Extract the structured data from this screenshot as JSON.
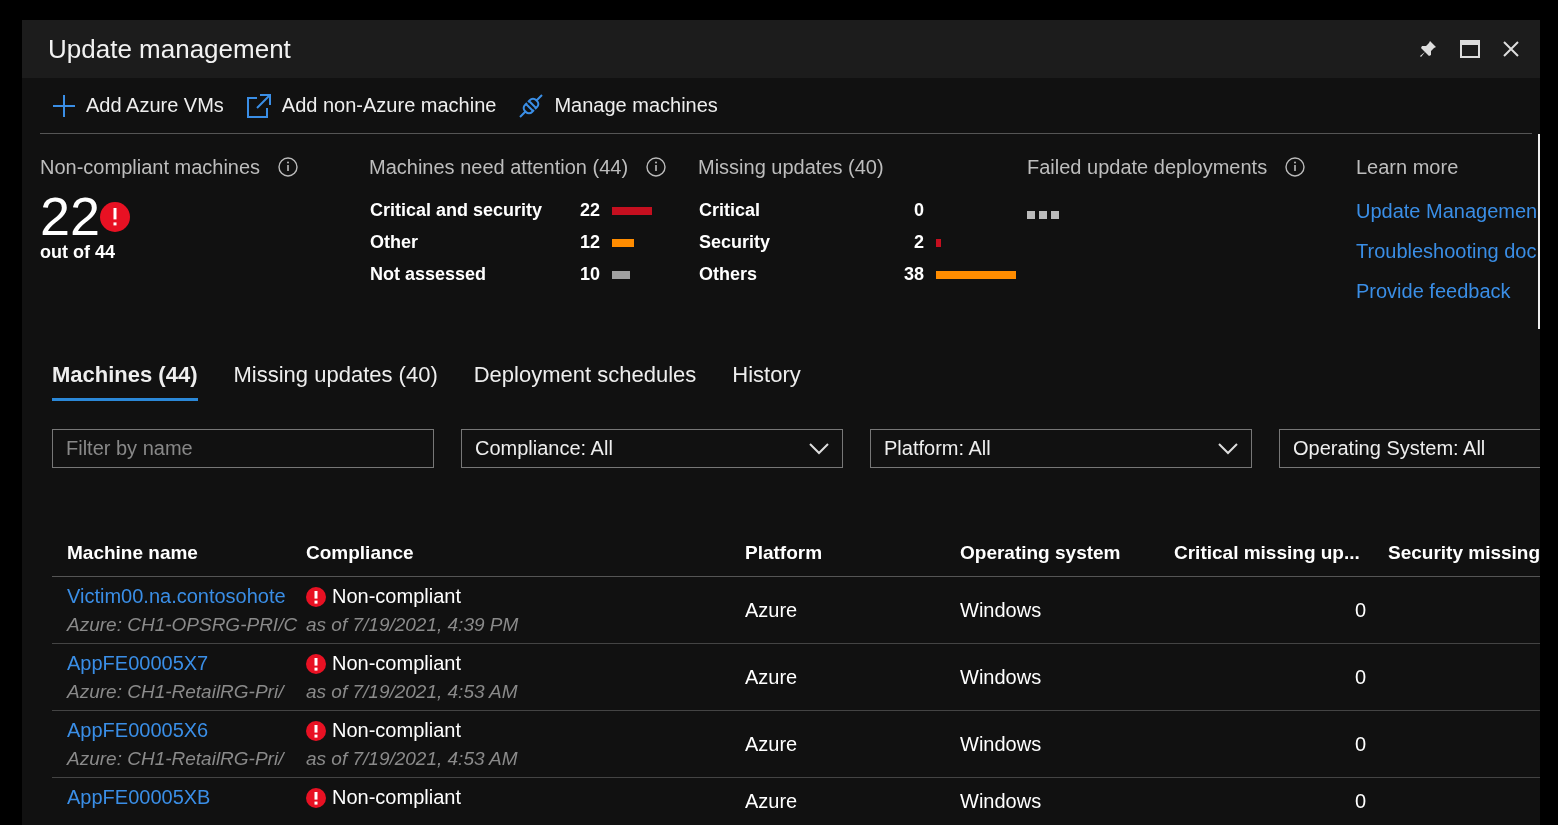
{
  "window": {
    "title": "Update management"
  },
  "toolbar": [
    {
      "label": "Add Azure VMs"
    },
    {
      "label": "Add non-Azure machine"
    },
    {
      "label": "Manage machines"
    }
  ],
  "summary": {
    "noncompliant": {
      "title": "Non-compliant machines",
      "value": "22",
      "subtitle": "out of 44"
    },
    "attention": {
      "title": "Machines need attention (44)",
      "rows": [
        {
          "label": "Critical and security",
          "count": "22",
          "color": "#c50f1f"
        },
        {
          "label": "Other",
          "count": "12",
          "color": "#ff8c00"
        },
        {
          "label": "Not assessed",
          "count": "10",
          "color": "#a0a0a0"
        }
      ]
    },
    "missing": {
      "title": "Missing updates (40)",
      "rows": [
        {
          "label": "Critical",
          "count": "0"
        },
        {
          "label": "Security",
          "count": "2",
          "color": "#c50f1f"
        },
        {
          "label": "Others",
          "count": "38",
          "color": "#ff8c00"
        }
      ]
    },
    "failed": {
      "title": "Failed update deployments"
    },
    "learn_more": {
      "title": "Learn more",
      "links": [
        "Update Managemen",
        "Troubleshooting doc",
        "Provide feedback"
      ]
    }
  },
  "tabs": [
    {
      "label": "Machines (44)",
      "selected": true
    },
    {
      "label": "Missing updates (40)",
      "selected": false
    },
    {
      "label": "Deployment schedules",
      "selected": false
    },
    {
      "label": "History",
      "selected": false
    }
  ],
  "filters": {
    "search": {
      "placeholder": "Filter by name"
    },
    "dropdowns": [
      "Compliance: All",
      "Platform: All",
      "Operating System: All"
    ]
  },
  "table": {
    "columns": [
      "Machine name",
      "Compliance",
      "Platform",
      "Operating system",
      "Critical missing up...",
      "Security missing"
    ],
    "rows": [
      {
        "name": "Victim00.na.contosohote",
        "detail": "Azure: CH1-OPSRG-PRI/C",
        "compliance": "Non-compliant",
        "as_of": "as of 7/19/2021, 4:39 PM",
        "platform": "Azure",
        "os": "Windows",
        "critical": "0"
      },
      {
        "name": "AppFE00005X7",
        "detail": "Azure: CH1-RetailRG-Pri/",
        "compliance": "Non-compliant",
        "as_of": "as of 7/19/2021, 4:53 AM",
        "platform": "Azure",
        "os": "Windows",
        "critical": "0"
      },
      {
        "name": "AppFE00005X6",
        "detail": "Azure: CH1-RetailRG-Pri/",
        "compliance": "Non-compliant",
        "as_of": "as of 7/19/2021, 4:53 AM",
        "platform": "Azure",
        "os": "Windows",
        "critical": "0"
      },
      {
        "name": "AppFE00005XB",
        "compliance": "Non-compliant",
        "platform": "Azure",
        "os": "Windows",
        "critical": "0"
      }
    ]
  }
}
